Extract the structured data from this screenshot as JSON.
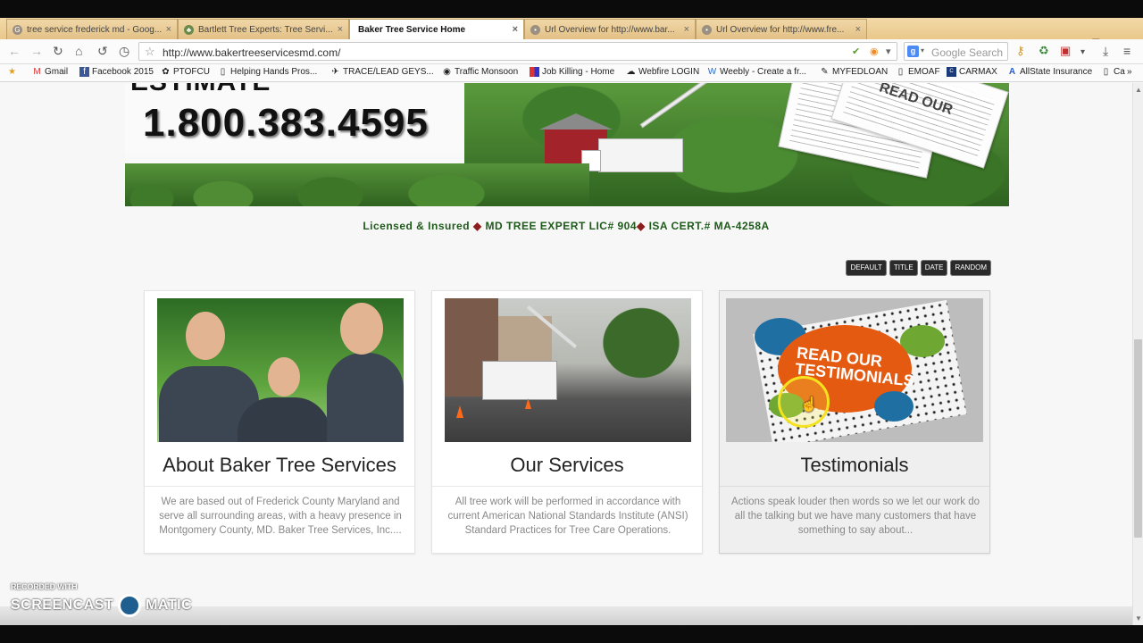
{
  "tabs": [
    {
      "label": "tree service frederick md - Goog...",
      "icon": "G",
      "active": false
    },
    {
      "label": "Bartlett Tree Experts: Tree Servi...",
      "icon": "tree",
      "active": false
    },
    {
      "label": "Baker Tree Service Home",
      "icon": "",
      "active": true
    },
    {
      "label": "Url Overview for http://www.bar...",
      "icon": "doc",
      "active": false
    },
    {
      "label": "Url Overview for http://www.fre...",
      "icon": "doc",
      "active": false
    }
  ],
  "address": {
    "url": "http://www.bakertreeservicesmd.com/"
  },
  "search": {
    "placeholder": "Google Search"
  },
  "bookmarks": [
    {
      "label": "Gmail"
    },
    {
      "label": "Facebook 2015"
    },
    {
      "label": "PTOFCU"
    },
    {
      "label": "Helping Hands Pros..."
    },
    {
      "label": "TRACE/LEAD GEYS..."
    },
    {
      "label": "Traffic Monsoon"
    },
    {
      "label": "Job Killing - Home"
    },
    {
      "label": "Webfire LOGIN"
    },
    {
      "label": "Weebly - Create a fr..."
    },
    {
      "label": "MYFEDLOAN"
    },
    {
      "label": "EMOAF"
    },
    {
      "label": "CARMAX"
    },
    {
      "label": "AllState Insurance"
    },
    {
      "label": "Ca"
    }
  ],
  "banner": {
    "estimate": "ESTIMATE",
    "phone": "1.800.383.4595"
  },
  "license": {
    "part1": "Licensed & Insured",
    "diamond": "◆",
    "part2": "MD TREE EXPERT LIC# 904",
    "part3": "ISA CERT.# MA-4258A"
  },
  "sort_buttons": [
    "DEFAULT",
    "TITLE",
    "DATE",
    "RANDOM"
  ],
  "cards": [
    {
      "title": "About Baker Tree Services",
      "desc": "We are based out of Frederick County Maryland and serve all surrounding areas, with a heavy presence in Montgomery County, MD. Baker Tree Services, Inc...."
    },
    {
      "title": "Our Services",
      "desc": "All tree work will be performed in accordance with current American National Standards Institute (ANSI) Standard Practices for Tree Care Operations."
    },
    {
      "title": "Testimonials",
      "desc": "Actions speak louder then words so we let our work do all the talking but we have many customers that have something to say about...",
      "image_text": "READ OUR TESTIMONIALS"
    }
  ],
  "watermark": {
    "line1": "RECORDED WITH",
    "line2": "SCREENCAST",
    "line3": "MATIC"
  },
  "colors": {
    "tab_bg": "#e9c88a",
    "license_green": "#1e5a1a",
    "diamond_red": "#8b1d1d",
    "sort_btn": "#2a2a2a"
  }
}
